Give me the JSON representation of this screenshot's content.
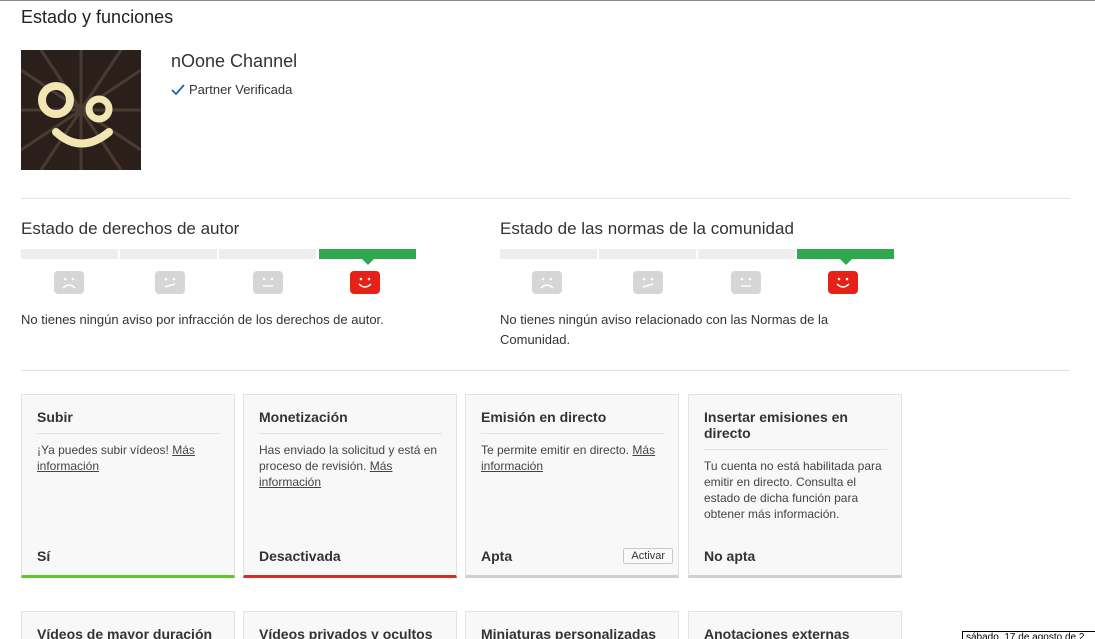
{
  "page": {
    "title": "Estado y funciones"
  },
  "channel": {
    "name": "nOone Channel",
    "partner_label": "Partner Verificada"
  },
  "copyright": {
    "title": "Estado de derechos de autor",
    "levels": 4,
    "active_level": 4,
    "message": "No tienes ningún aviso por infracción de los derechos de autor."
  },
  "community": {
    "title": "Estado de las normas de la comunidad",
    "levels": 4,
    "active_level": 4,
    "message": "No tienes ningún aviso relacionado con las Normas de la Comunidad."
  },
  "features": [
    {
      "title": "Subir",
      "desc": "¡Ya puedes subir vídeos!",
      "more": "Más información",
      "status": "Sí",
      "bar": "green"
    },
    {
      "title": "Monetización",
      "desc": "Has enviado la solicitud y está en proceso de revisión.",
      "more": "Más información",
      "status": "Desactivada",
      "bar": "red"
    },
    {
      "title": "Emisión en directo",
      "desc": "Te permite emitir en directo.",
      "more": "Más información",
      "status": "Apta",
      "bar": "gray",
      "button": "Activar"
    },
    {
      "title": "Insertar emisiones en directo",
      "desc": "Tu cuenta no está habilitada para emitir en directo. Consulta el estado de dicha función para obtener más información.",
      "more": "",
      "status": "No apta",
      "bar": "gray"
    }
  ],
  "features_row2": [
    {
      "title": "Vídeos de mayor duración"
    },
    {
      "title": "Vídeos privados y ocultos"
    },
    {
      "title": "Miniaturas personalizadas"
    },
    {
      "title": "Anotaciones externas"
    }
  ],
  "footer": {
    "date_text": "sábado, 17 de agosto de 2"
  },
  "colors": {
    "active_meter": "#2fa84f",
    "active_face": "#e62117",
    "status_ok": "#5cc72d",
    "status_bad": "#d32d27"
  }
}
